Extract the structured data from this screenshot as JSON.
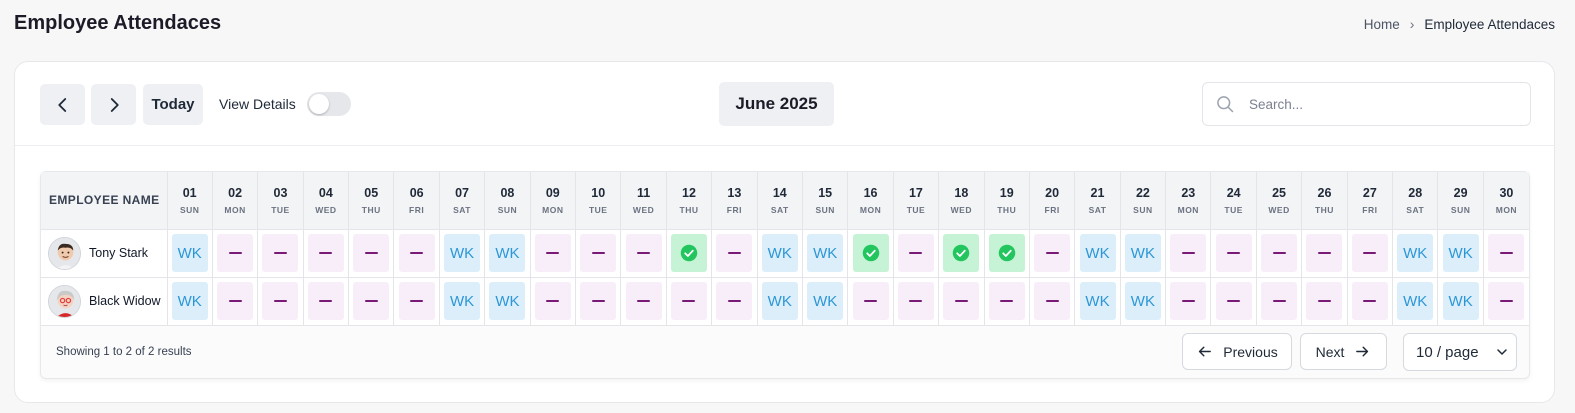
{
  "page": {
    "title": "Employee Attendaces"
  },
  "breadcrumb": {
    "home": "Home",
    "separator": "›",
    "current": "Employee Attendaces"
  },
  "toolbar": {
    "today_label": "Today",
    "view_details_label": "View Details",
    "view_details_on": false,
    "month_label": "June 2025",
    "search_placeholder": "Search..."
  },
  "table": {
    "name_header": "EMPLOYEE NAME",
    "days": [
      {
        "num": "01",
        "wd": "SUN"
      },
      {
        "num": "02",
        "wd": "MON"
      },
      {
        "num": "03",
        "wd": "TUE"
      },
      {
        "num": "04",
        "wd": "WED"
      },
      {
        "num": "05",
        "wd": "THU"
      },
      {
        "num": "06",
        "wd": "FRI"
      },
      {
        "num": "07",
        "wd": "SAT"
      },
      {
        "num": "08",
        "wd": "SUN"
      },
      {
        "num": "09",
        "wd": "MON"
      },
      {
        "num": "10",
        "wd": "TUE"
      },
      {
        "num": "11",
        "wd": "WED"
      },
      {
        "num": "12",
        "wd": "THU"
      },
      {
        "num": "13",
        "wd": "FRI"
      },
      {
        "num": "14",
        "wd": "SAT"
      },
      {
        "num": "15",
        "wd": "SUN"
      },
      {
        "num": "16",
        "wd": "MON"
      },
      {
        "num": "17",
        "wd": "TUE"
      },
      {
        "num": "18",
        "wd": "WED"
      },
      {
        "num": "19",
        "wd": "THU"
      },
      {
        "num": "20",
        "wd": "FRI"
      },
      {
        "num": "21",
        "wd": "SAT"
      },
      {
        "num": "22",
        "wd": "SUN"
      },
      {
        "num": "23",
        "wd": "MON"
      },
      {
        "num": "24",
        "wd": "TUE"
      },
      {
        "num": "25",
        "wd": "WED"
      },
      {
        "num": "26",
        "wd": "THU"
      },
      {
        "num": "27",
        "wd": "FRI"
      },
      {
        "num": "28",
        "wd": "SAT"
      },
      {
        "num": "29",
        "wd": "SUN"
      },
      {
        "num": "30",
        "wd": "MON"
      }
    ],
    "status_legend": {
      "weekend_label": "WK",
      "absent_icon": "dash-icon",
      "present_icon": "check-circle-icon"
    },
    "rows": [
      {
        "name": "Tony Stark",
        "avatar_icon": "avatar-man-icon",
        "statuses": [
          "WK",
          "absent",
          "absent",
          "absent",
          "absent",
          "absent",
          "WK",
          "WK",
          "absent",
          "absent",
          "absent",
          "present",
          "absent",
          "WK",
          "WK",
          "present",
          "absent",
          "present",
          "present",
          "absent",
          "WK",
          "WK",
          "absent",
          "absent",
          "absent",
          "absent",
          "absent",
          "WK",
          "WK",
          "absent"
        ]
      },
      {
        "name": "Black Widow",
        "avatar_icon": "avatar-woman-icon",
        "statuses": [
          "WK",
          "absent",
          "absent",
          "absent",
          "absent",
          "absent",
          "WK",
          "WK",
          "absent",
          "absent",
          "absent",
          "absent",
          "absent",
          "WK",
          "WK",
          "absent",
          "absent",
          "absent",
          "absent",
          "absent",
          "WK",
          "WK",
          "absent",
          "absent",
          "absent",
          "absent",
          "absent",
          "WK",
          "WK",
          "absent"
        ]
      }
    ]
  },
  "pagination": {
    "showing_text": "Showing 1 to 2 of 2 results",
    "previous_label": "Previous",
    "next_label": "Next",
    "page_size_label": "10 / page"
  },
  "colors": {
    "weekend_bg": "#ddeefb",
    "weekend_text": "#2b97d6",
    "absent_bg": "#f8eefa",
    "absent_mark": "#7a1a77",
    "present_bg": "#c6f3d6",
    "present_icon": "#22c55e"
  }
}
